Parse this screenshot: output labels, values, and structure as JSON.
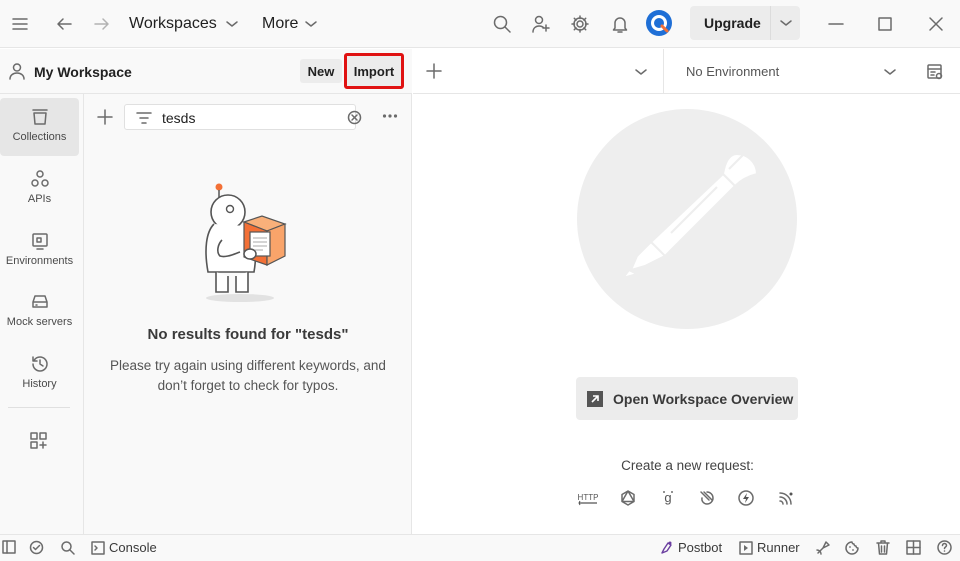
{
  "titlebar": {
    "workspaces_label": "Workspaces",
    "more_label": "More",
    "upgrade_label": "Upgrade"
  },
  "workspace": {
    "name": "My Workspace",
    "new_label": "New",
    "import_label": "Import"
  },
  "sidebar": {
    "items": [
      {
        "label": "Collections",
        "icon": "collections-icon",
        "active": true
      },
      {
        "label": "APIs",
        "icon": "apis-icon",
        "active": false
      },
      {
        "label": "Environments",
        "icon": "environments-icon",
        "active": false
      },
      {
        "label": "Mock servers",
        "icon": "mock-servers-icon",
        "active": false
      },
      {
        "label": "History",
        "icon": "history-icon",
        "active": false
      }
    ]
  },
  "collections": {
    "search_value": "tesds",
    "empty_title": "No results found for \"tesds\"",
    "empty_desc_line1": "Please try again using different keywords, and",
    "empty_desc_line2": "don’t forget to check for typos."
  },
  "main": {
    "environment": "No Environment",
    "overview_button": "Open Workspace Overview",
    "create_label": "Create a new request:",
    "request_types": [
      "http-icon",
      "graphql-icon",
      "grpc-icon",
      "websocket-icon",
      "socketio-icon",
      "mqtt-icon"
    ],
    "http_text": "HTTP"
  },
  "statusbar": {
    "console_label": "Console",
    "postbot_label": "Postbot",
    "runner_label": "Runner"
  },
  "colors": {
    "accent_orange": "#f37036",
    "highlight_red": "#e01212",
    "postbot_purple": "#6b3fa0",
    "avatar_blue": "#1f6fd6"
  }
}
